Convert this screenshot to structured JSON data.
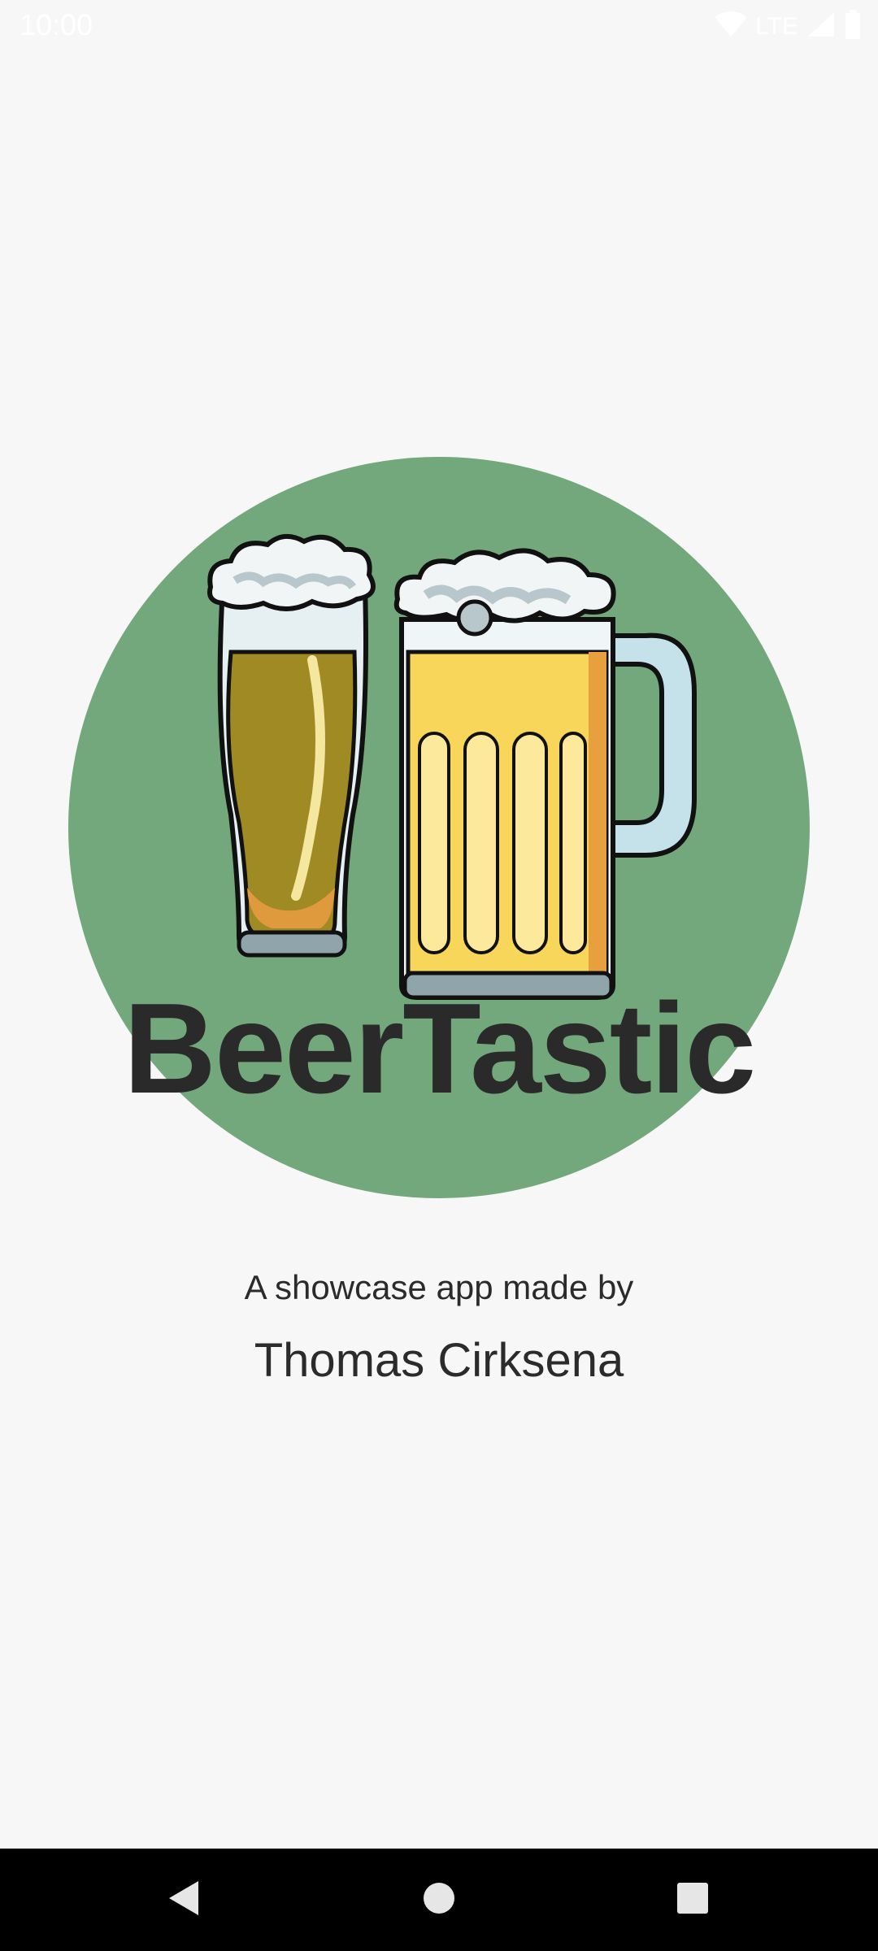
{
  "status_bar": {
    "time": "10:00",
    "network": "LTE",
    "icons": [
      "wifi-icon",
      "signal-icon",
      "battery-icon"
    ]
  },
  "splash": {
    "title": "BeerTastic",
    "subtitle": "A showcase app made by",
    "author": "Thomas Cirksena",
    "circle_color": "#73a77c",
    "title_color": "#2a2a2a"
  },
  "nav_bar": {
    "buttons": [
      "back-icon",
      "home-icon",
      "recents-icon"
    ]
  }
}
